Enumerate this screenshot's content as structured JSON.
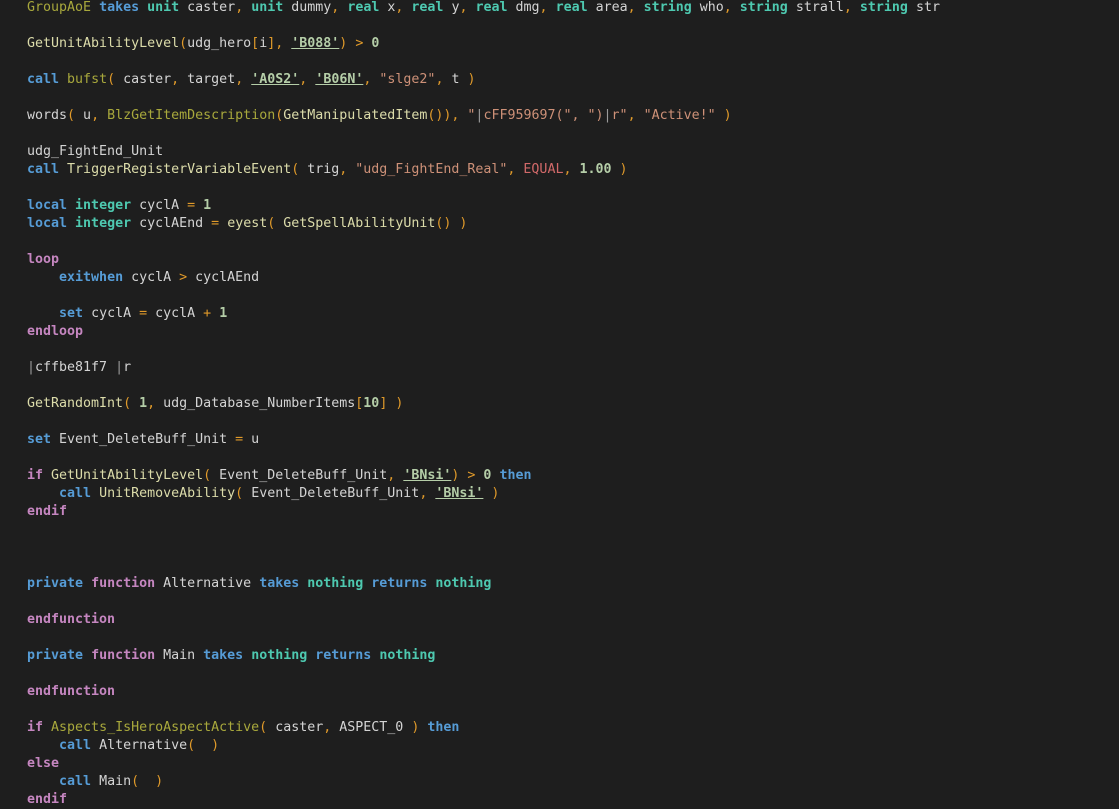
{
  "colors": {
    "background": "#1e1e1e",
    "keyword": "#569cd6",
    "type": "#4ec9b0",
    "control": "#c586c0",
    "string": "#ce9178",
    "number": "#b5cea8"
  },
  "lines": [
    [
      [
        "fn",
        "GroupAoE"
      ],
      [
        "id",
        " "
      ],
      [
        "kw",
        "takes"
      ],
      [
        "id",
        " "
      ],
      [
        "type",
        "unit"
      ],
      [
        "id",
        " caster"
      ],
      [
        "op",
        ","
      ],
      [
        "id",
        " "
      ],
      [
        "type",
        "unit"
      ],
      [
        "id",
        " dummy"
      ],
      [
        "op",
        ","
      ],
      [
        "id",
        " "
      ],
      [
        "type",
        "real"
      ],
      [
        "id",
        " x"
      ],
      [
        "op",
        ","
      ],
      [
        "id",
        " "
      ],
      [
        "type",
        "real"
      ],
      [
        "id",
        " y"
      ],
      [
        "op",
        ","
      ],
      [
        "id",
        " "
      ],
      [
        "type",
        "real"
      ],
      [
        "id",
        " dmg"
      ],
      [
        "op",
        ","
      ],
      [
        "id",
        " "
      ],
      [
        "type",
        "real"
      ],
      [
        "id",
        " area"
      ],
      [
        "op",
        ","
      ],
      [
        "id",
        " "
      ],
      [
        "type",
        "string"
      ],
      [
        "id",
        " who"
      ],
      [
        "op",
        ","
      ],
      [
        "id",
        " "
      ],
      [
        "type",
        "string"
      ],
      [
        "id",
        " strall"
      ],
      [
        "op",
        ","
      ],
      [
        "id",
        " "
      ],
      [
        "type",
        "string"
      ],
      [
        "id",
        " str"
      ]
    ],
    [],
    [
      [
        "fn2",
        "GetUnitAbilityLevel"
      ],
      [
        "op",
        "("
      ],
      [
        "id",
        "udg_hero"
      ],
      [
        "op",
        "["
      ],
      [
        "id",
        "i"
      ],
      [
        "op",
        "]"
      ],
      [
        "op",
        ","
      ],
      [
        "id",
        " "
      ],
      [
        "raw",
        "'B088'"
      ],
      [
        "op",
        ")"
      ],
      [
        "id",
        " "
      ],
      [
        "op",
        ">"
      ],
      [
        "id",
        " "
      ],
      [
        "num",
        "0"
      ]
    ],
    [],
    [
      [
        "kw",
        "call"
      ],
      [
        "id",
        " "
      ],
      [
        "fn",
        "bufst"
      ],
      [
        "op",
        "("
      ],
      [
        "id",
        " caster"
      ],
      [
        "op",
        ","
      ],
      [
        "id",
        " target"
      ],
      [
        "op",
        ","
      ],
      [
        "id",
        " "
      ],
      [
        "raw",
        "'A0S2'"
      ],
      [
        "op",
        ","
      ],
      [
        "id",
        " "
      ],
      [
        "raw",
        "'B06N'"
      ],
      [
        "op",
        ","
      ],
      [
        "id",
        " "
      ],
      [
        "str",
        "\"slge2\""
      ],
      [
        "op",
        ","
      ],
      [
        "id",
        " t "
      ],
      [
        "op",
        ")"
      ]
    ],
    [],
    [
      [
        "id",
        "words"
      ],
      [
        "op",
        "("
      ],
      [
        "id",
        " u"
      ],
      [
        "op",
        ","
      ],
      [
        "id",
        " "
      ],
      [
        "fn",
        "BlzGetItemDescription"
      ],
      [
        "op",
        "("
      ],
      [
        "fn2",
        "GetManipulatedItem"
      ],
      [
        "op",
        "())"
      ],
      [
        "op",
        ","
      ],
      [
        "id",
        " "
      ],
      [
        "str",
        "\""
      ],
      [
        "esc",
        "|"
      ],
      [
        "str",
        "cFF959697(\", \")"
      ],
      [
        "esc",
        "|"
      ],
      [
        "str",
        "r\""
      ],
      [
        "op",
        ","
      ],
      [
        "id",
        " "
      ],
      [
        "str",
        "\"Active!\""
      ],
      [
        "id",
        " "
      ],
      [
        "op",
        ")"
      ]
    ],
    [],
    [
      [
        "id",
        "udg_FightEnd_Unit"
      ]
    ],
    [
      [
        "kw",
        "call"
      ],
      [
        "id",
        " "
      ],
      [
        "fn2",
        "TriggerRegisterVariableEvent"
      ],
      [
        "op",
        "("
      ],
      [
        "id",
        " trig"
      ],
      [
        "op",
        ","
      ],
      [
        "id",
        " "
      ],
      [
        "str",
        "\"udg_FightEnd_Real\""
      ],
      [
        "op",
        ","
      ],
      [
        "id",
        " "
      ],
      [
        "const",
        "EQUAL"
      ],
      [
        "op",
        ","
      ],
      [
        "id",
        " "
      ],
      [
        "num",
        "1.00"
      ],
      [
        "id",
        " "
      ],
      [
        "op",
        ")"
      ]
    ],
    [],
    [
      [
        "kw",
        "local"
      ],
      [
        "id",
        " "
      ],
      [
        "type",
        "integer"
      ],
      [
        "id",
        " cyclA "
      ],
      [
        "op",
        "="
      ],
      [
        "id",
        " "
      ],
      [
        "num",
        "1"
      ]
    ],
    [
      [
        "kw",
        "local"
      ],
      [
        "id",
        " "
      ],
      [
        "type",
        "integer"
      ],
      [
        "id",
        " cyclAEnd "
      ],
      [
        "op",
        "="
      ],
      [
        "id",
        " "
      ],
      [
        "fn2",
        "eyest"
      ],
      [
        "op",
        "("
      ],
      [
        "id",
        " "
      ],
      [
        "fn2",
        "GetSpellAbilityUnit"
      ],
      [
        "op",
        "()"
      ],
      [
        "id",
        " "
      ],
      [
        "op",
        ")"
      ]
    ],
    [],
    [
      [
        "ctl",
        "loop"
      ]
    ],
    [
      [
        "id",
        "    "
      ],
      [
        "kw",
        "exitwhen"
      ],
      [
        "id",
        " cyclA "
      ],
      [
        "op",
        ">"
      ],
      [
        "id",
        " cyclAEnd"
      ]
    ],
    [],
    [
      [
        "id",
        "    "
      ],
      [
        "kw",
        "set"
      ],
      [
        "id",
        " cyclA "
      ],
      [
        "op",
        "="
      ],
      [
        "id",
        " cyclA "
      ],
      [
        "op",
        "+"
      ],
      [
        "id",
        " "
      ],
      [
        "num",
        "1"
      ]
    ],
    [
      [
        "ctl",
        "endloop"
      ]
    ],
    [],
    [
      [
        "esc",
        "|"
      ],
      [
        "id",
        "cffbe81f7 "
      ],
      [
        "esc",
        "|"
      ],
      [
        "id",
        "r"
      ]
    ],
    [],
    [
      [
        "fn2",
        "GetRandomInt"
      ],
      [
        "op",
        "("
      ],
      [
        "id",
        " "
      ],
      [
        "num",
        "1"
      ],
      [
        "op",
        ","
      ],
      [
        "id",
        " udg_Database_NumberItems"
      ],
      [
        "op",
        "["
      ],
      [
        "num",
        "10"
      ],
      [
        "op",
        "]"
      ],
      [
        "id",
        " "
      ],
      [
        "op",
        ")"
      ]
    ],
    [],
    [
      [
        "kw",
        "set"
      ],
      [
        "id",
        " Event_DeleteBuff_Unit "
      ],
      [
        "op",
        "="
      ],
      [
        "id",
        " u"
      ]
    ],
    [],
    [
      [
        "ctl",
        "if"
      ],
      [
        "id",
        " "
      ],
      [
        "fn2",
        "GetUnitAbilityLevel"
      ],
      [
        "op",
        "("
      ],
      [
        "id",
        " Event_DeleteBuff_Unit"
      ],
      [
        "op",
        ","
      ],
      [
        "id",
        " "
      ],
      [
        "raw",
        "'BNsi'"
      ],
      [
        "op",
        ")"
      ],
      [
        "id",
        " "
      ],
      [
        "op",
        ">"
      ],
      [
        "id",
        " "
      ],
      [
        "num",
        "0"
      ],
      [
        "id",
        " "
      ],
      [
        "kw",
        "then"
      ]
    ],
    [
      [
        "id",
        "    "
      ],
      [
        "kw",
        "call"
      ],
      [
        "id",
        " "
      ],
      [
        "fn2",
        "UnitRemoveAbility"
      ],
      [
        "op",
        "("
      ],
      [
        "id",
        " Event_DeleteBuff_Unit"
      ],
      [
        "op",
        ","
      ],
      [
        "id",
        " "
      ],
      [
        "raw",
        "'BNsi'"
      ],
      [
        "id",
        " "
      ],
      [
        "op",
        ")"
      ]
    ],
    [
      [
        "ctl",
        "endif"
      ]
    ],
    [],
    [],
    [],
    [
      [
        "kw",
        "private"
      ],
      [
        "id",
        " "
      ],
      [
        "ctl",
        "function"
      ],
      [
        "id",
        " Alternative "
      ],
      [
        "kw",
        "takes"
      ],
      [
        "id",
        " "
      ],
      [
        "type",
        "nothing"
      ],
      [
        "id",
        " "
      ],
      [
        "kw",
        "returns"
      ],
      [
        "id",
        " "
      ],
      [
        "type",
        "nothing"
      ]
    ],
    [],
    [
      [
        "ctl",
        "endfunction"
      ]
    ],
    [],
    [
      [
        "kw",
        "private"
      ],
      [
        "id",
        " "
      ],
      [
        "ctl",
        "function"
      ],
      [
        "id",
        " Main "
      ],
      [
        "kw",
        "takes"
      ],
      [
        "id",
        " "
      ],
      [
        "type",
        "nothing"
      ],
      [
        "id",
        " "
      ],
      [
        "kw",
        "returns"
      ],
      [
        "id",
        " "
      ],
      [
        "type",
        "nothing"
      ]
    ],
    [],
    [
      [
        "ctl",
        "endfunction"
      ]
    ],
    [],
    [
      [
        "ctl",
        "if"
      ],
      [
        "id",
        " "
      ],
      [
        "fn",
        "Aspects_IsHeroAspectActive"
      ],
      [
        "op",
        "("
      ],
      [
        "id",
        " caster"
      ],
      [
        "op",
        ","
      ],
      [
        "id",
        " ASPECT_0 "
      ],
      [
        "op",
        ")"
      ],
      [
        "id",
        " "
      ],
      [
        "kw",
        "then"
      ]
    ],
    [
      [
        "id",
        "    "
      ],
      [
        "kw",
        "call"
      ],
      [
        "id",
        " Alternative"
      ],
      [
        "op",
        "("
      ],
      [
        "id",
        "  "
      ],
      [
        "op",
        ")"
      ]
    ],
    [
      [
        "ctl",
        "else"
      ]
    ],
    [
      [
        "id",
        "    "
      ],
      [
        "kw",
        "call"
      ],
      [
        "id",
        " Main"
      ],
      [
        "op",
        "("
      ],
      [
        "id",
        "  "
      ],
      [
        "op",
        ")"
      ]
    ],
    [
      [
        "ctl",
        "endif"
      ]
    ]
  ]
}
